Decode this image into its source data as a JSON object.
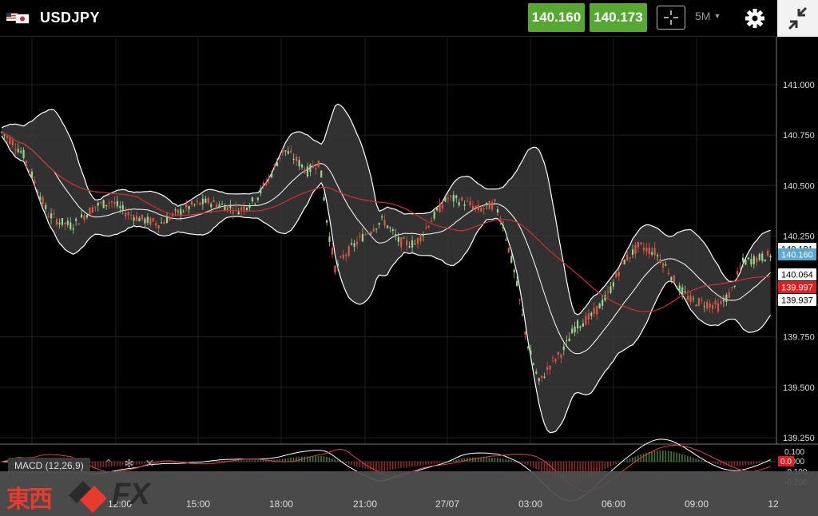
{
  "header": {
    "symbol": "USDJPY",
    "sell_price": "140.160",
    "buy_price": "140.173",
    "timeframe": "5M",
    "icons": [
      "us-flag-icon",
      "jp-flag-icon",
      "crosshair-icon",
      "gear-icon",
      "collapse-icon"
    ]
  },
  "chart": {
    "price_ticks": [
      "141.000",
      "140.750",
      "140.500",
      "140.250",
      "139.750",
      "139.500",
      "139.250"
    ],
    "tags": {
      "upper": "140.181",
      "current": "140.160",
      "middle": "140.064",
      "ma": "139.997",
      "lower": "139.937"
    },
    "colors": {
      "up_candle": "#9ad38a",
      "down_candle": "#e0573f",
      "band": "#ffffff",
      "ma_line": "#d32f2f",
      "current_tag": "#5aa7d6",
      "ma_tag": "#e01e1e"
    }
  },
  "macd": {
    "label": "MACD (12,26,9)",
    "ticks": [
      "0.100",
      "0.000",
      "-0.100",
      "-0.200"
    ],
    "tag": "0.0",
    "tools": [
      "arrow-up-icon",
      "settings-icon",
      "close-icon"
    ]
  },
  "time_axis": [
    "12:00",
    "15:00",
    "18:00",
    "21:00",
    "27/07",
    "03:00",
    "06:00",
    "09:00",
    "12"
  ],
  "logo": {
    "kanji": "東西",
    "fx": "FX"
  }
}
